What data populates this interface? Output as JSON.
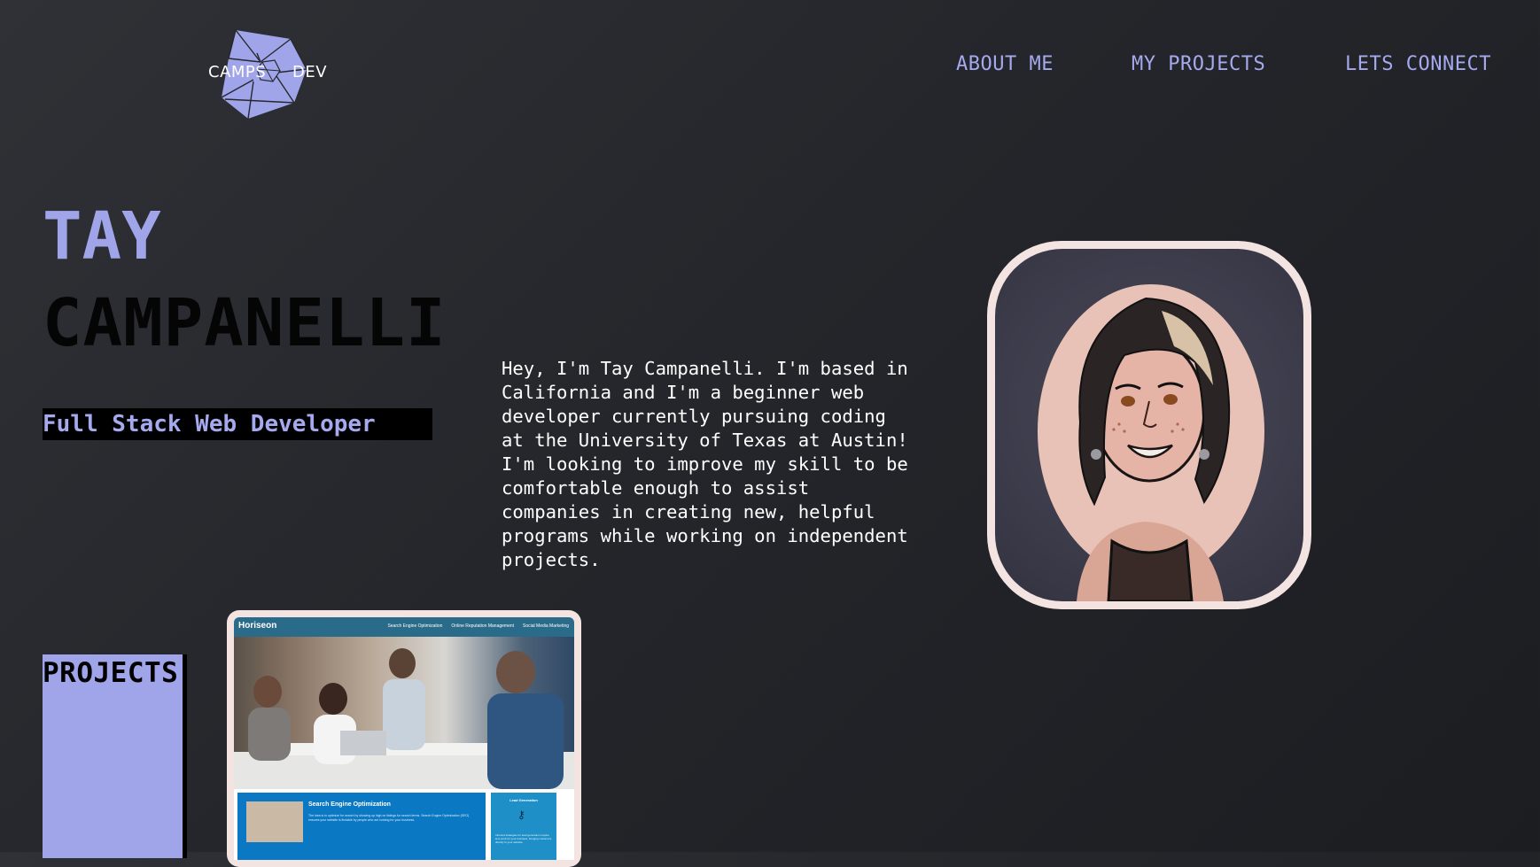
{
  "brand": {
    "left_text": "CAMPS",
    "right_text": "DEV",
    "logo_icon": "geodesic-polyhedron-icon",
    "accent_color": "#a0a5ea"
  },
  "nav": {
    "items": [
      {
        "label": "ABOUT ME"
      },
      {
        "label": "MY PROJECTS"
      },
      {
        "label": "LETS CONNECT"
      }
    ]
  },
  "hero": {
    "first_name": "TAY",
    "last_name": "CAMPANELLI",
    "subtitle": "Full Stack Web Developer",
    "bio": "Hey, I'm Tay Campanelli. I'm based in\nCalifornia and I'm a beginner web\ndeveloper currently pursuing coding\nat the University of Texas at Austin!\nI'm looking to improve my skill to be\ncomfortable enough to assist\ncompanies in creating new, helpful\nprograms while working on independent\nprojects.",
    "avatar": "illustrated-portrait-avatar"
  },
  "projects": {
    "heading": "PROJECTS",
    "cards": [
      {
        "site_brand": "Horiseon",
        "site_nav": [
          "Search Engine Optimization",
          "Online Reputation Management",
          "Social Media Marketing"
        ],
        "section_title": "Search Engine Optimization",
        "section_text": "The idea is to optimize for search by showing up high on listings for search terms. Search Engine Optimization (SEO) ensures your website is findable by people who are looking for your business.",
        "aside_title": "Lead Generation",
        "aside_icon": "key-icon",
        "aside_text": "Inbound strategies for lead generation require less work for your business, bringing customers directly to your website."
      }
    ]
  },
  "colors": {
    "background": "#26282d",
    "accent": "#a0a5ea",
    "frame": "#f3e4e2",
    "subtitle_bg": "#000000"
  }
}
